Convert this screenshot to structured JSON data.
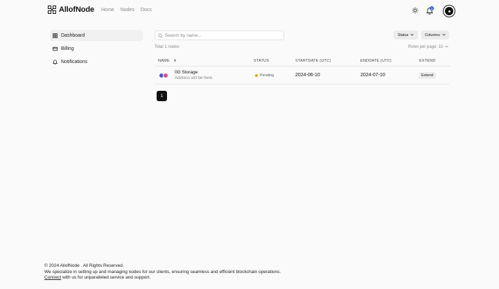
{
  "header": {
    "brand": "AllofNode",
    "nav": [
      "Home",
      "Nodes",
      "Docs"
    ],
    "notification_count": "1",
    "icons": {
      "theme": "sun-icon",
      "notifications": "bell-icon"
    }
  },
  "sidebar": {
    "items": [
      {
        "label": "Dashboard",
        "icon": "grid-icon",
        "active": true
      },
      {
        "label": "Billing",
        "icon": "card-icon",
        "active": false
      },
      {
        "label": "Notifications",
        "icon": "bell-icon",
        "active": false
      }
    ]
  },
  "toolbar": {
    "search_placeholder": "Search by name...",
    "status_label": "Status",
    "columns_label": "Columns",
    "total": "Total 1 nodes",
    "rows_per_page": "Rows per page: 10"
  },
  "table": {
    "headers": [
      "NAME",
      "STATUS",
      "STARTDATE (UTC)",
      "ENDDATE (UTC)",
      "EXTEND"
    ],
    "rows": [
      {
        "name": "0G Storage",
        "address": "Address will be here.",
        "status": "Pending",
        "startdate": "2024-06-10",
        "enddate": "2024-07-10",
        "extend": "Extend"
      }
    ]
  },
  "pagination": {
    "current": "1"
  },
  "footer": {
    "copyright": "© 2024 AllofNode . All Rights Reserved.",
    "line2": "We specialize in setting up and managing nodes for our clients, ensuring seamless and efficient blockchain operations.",
    "link": "Connect",
    "line3_rest": " with us for unparalleled service and support."
  },
  "colors": {
    "accent": "#3b5bdb",
    "pending": "#f59f00",
    "dark": "#111111"
  }
}
